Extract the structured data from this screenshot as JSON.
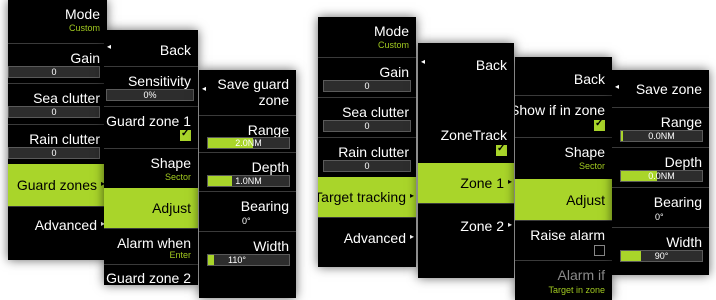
{
  "left_group": {
    "main_menu": {
      "mode": {
        "label": "Mode",
        "value": "Custom"
      },
      "gain": {
        "label": "Gain",
        "value": "0"
      },
      "sea_clutter": {
        "label": "Sea clutter",
        "value": "0"
      },
      "rain_clutter": {
        "label": "Rain clutter",
        "value": "0"
      },
      "guard_zones": {
        "label": "Guard zones"
      },
      "advanced": {
        "label": "Advanced"
      }
    },
    "guard_zones_menu": {
      "back": "Back",
      "sensitivity": {
        "label": "Sensitivity",
        "value": "0%"
      },
      "guard_zone_1": {
        "label": "Guard zone 1",
        "checked": true
      },
      "shape": {
        "label": "Shape",
        "value": "Sector"
      },
      "adjust": "Adjust",
      "alarm_when": {
        "label": "Alarm when",
        "value": "Enter"
      },
      "guard_zone_2": {
        "label": "Guard zone 2"
      }
    },
    "adjust_menu": {
      "save": "Save guard zone",
      "range": {
        "label": "Range",
        "value": "2.0NM",
        "fill_fraction": 0.55
      },
      "depth": {
        "label": "Depth",
        "value": "1.0NM",
        "fill_fraction": 0.3
      },
      "bearing": {
        "label": "Bearing",
        "value": "0°"
      },
      "width": {
        "label": "Width",
        "value": "110°",
        "fill_fraction": 0.08
      }
    }
  },
  "right_group": {
    "main_menu": {
      "mode": {
        "label": "Mode",
        "value": "Custom"
      },
      "gain": {
        "label": "Gain",
        "value": "0"
      },
      "sea_clutter": {
        "label": "Sea clutter",
        "value": "0"
      },
      "rain_clutter": {
        "label": "Rain clutter",
        "value": "0"
      },
      "target_tracking": {
        "label": "Target tracking"
      },
      "advanced": {
        "label": "Advanced"
      }
    },
    "tracking_menu": {
      "back": "Back",
      "zonetrack": {
        "label": "ZoneTrack",
        "checked": true
      },
      "zone1": "Zone 1",
      "zone2": "Zone 2"
    },
    "zone_menu": {
      "back": "Back",
      "show_if_in_zone": {
        "label": "Show if in zone",
        "checked": true
      },
      "shape": {
        "label": "Shape",
        "value": "Sector"
      },
      "adjust": "Adjust",
      "raise_alarm": {
        "label": "Raise alarm",
        "checked": false
      },
      "alarm_if": {
        "label": "Alarm if",
        "value": "Target in zone"
      }
    },
    "save_zone_menu": {
      "save": "Save zone",
      "range": {
        "label": "Range",
        "value": "0.0NM",
        "fill_fraction": 0.02
      },
      "depth": {
        "label": "Depth",
        "value": "0.0NM",
        "fill_fraction": 0.45
      },
      "bearing": {
        "label": "Bearing",
        "value": "0°"
      },
      "width": {
        "label": "Width",
        "value": "90°",
        "fill_fraction": 0.25
      }
    }
  },
  "icons": {
    "right_arrow": "▸",
    "left_arrow": "◂"
  },
  "colors": {
    "accent": "#a9d52a",
    "panel": "#000000",
    "divider": "#3a3a3a"
  }
}
